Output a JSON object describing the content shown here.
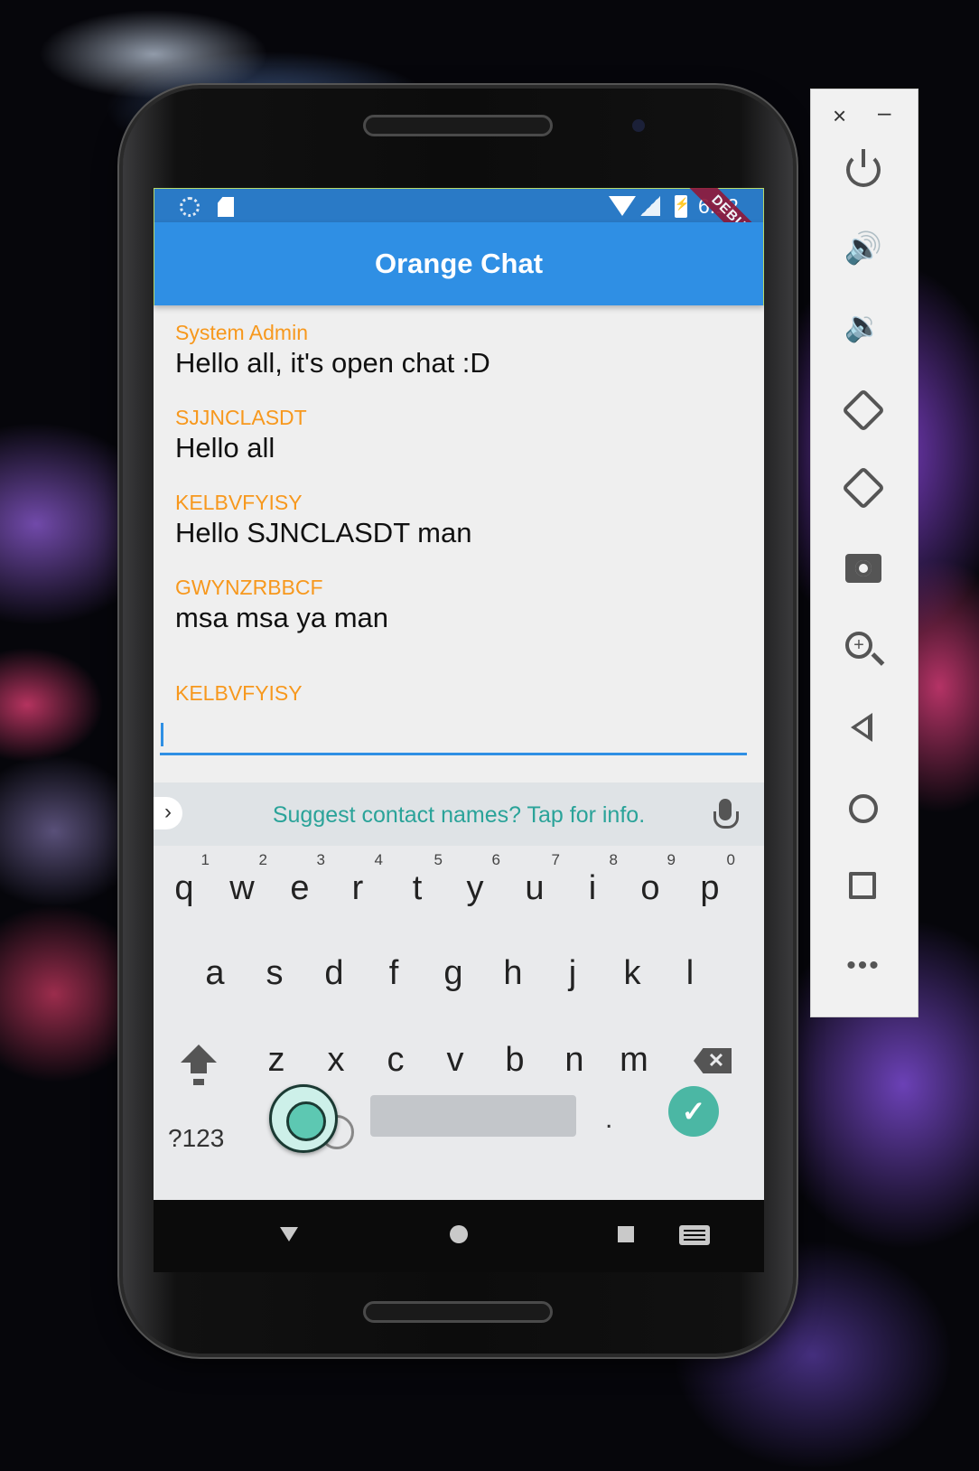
{
  "statusbar": {
    "time": "6:12",
    "debug_label": "DEBUG"
  },
  "appbar": {
    "title": "Orange Chat"
  },
  "messages": [
    {
      "sender": "System Admin",
      "text": "Hello all, it's open chat :D"
    },
    {
      "sender": "SJJNCLASDT",
      "text": "Hello all"
    },
    {
      "sender": "KELBVFYISY",
      "text": "Hello SJNCLASDT man"
    },
    {
      "sender": "GWYNZRBBCF",
      "text": "msa msa ya man"
    }
  ],
  "composer": {
    "sender": "KELBVFYISY",
    "value": ""
  },
  "keyboard": {
    "suggestion": "Suggest contact names? Tap for info.",
    "row1": [
      {
        "key": "q",
        "hint": "1"
      },
      {
        "key": "w",
        "hint": "2"
      },
      {
        "key": "e",
        "hint": "3"
      },
      {
        "key": "r",
        "hint": "4"
      },
      {
        "key": "t",
        "hint": "5"
      },
      {
        "key": "y",
        "hint": "6"
      },
      {
        "key": "u",
        "hint": "7"
      },
      {
        "key": "i",
        "hint": "8"
      },
      {
        "key": "o",
        "hint": "9"
      },
      {
        "key": "p",
        "hint": "0"
      }
    ],
    "row2": [
      "a",
      "s",
      "d",
      "f",
      "g",
      "h",
      "j",
      "k",
      "l"
    ],
    "row3": [
      "z",
      "x",
      "c",
      "v",
      "b",
      "n",
      "m"
    ],
    "symbols_label": "?123",
    "period_label": ".",
    "done_label": "✓"
  },
  "toolbar": {
    "close_label": "×",
    "minimize_label": "–",
    "more_label": "•••"
  },
  "icons": {
    "statusbar": [
      "sync-icon",
      "sd-card-icon",
      "wifi-icon",
      "signal-icon",
      "battery-icon"
    ],
    "toolbar": [
      "power-icon",
      "volume-up-icon",
      "volume-down-icon",
      "rotate-left-icon",
      "rotate-right-icon",
      "camera-icon",
      "zoom-icon",
      "back-icon",
      "home-icon",
      "overview-icon",
      "more-icon"
    ]
  },
  "colors": {
    "appbar": "#2f8fe4",
    "statusbar": "#2a7ac6",
    "sender": "#f7981d",
    "suggestion": "#2aa399",
    "done_key": "#4bb7a4"
  }
}
